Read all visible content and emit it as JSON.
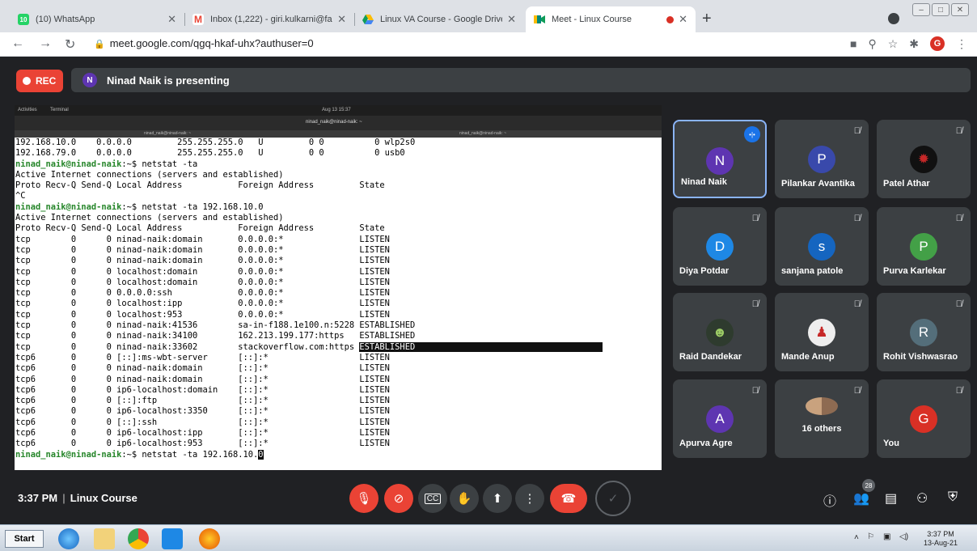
{
  "browser": {
    "tabs": [
      {
        "title": "(10) WhatsApp",
        "favicon": "whatsapp-icon",
        "color": "#25d366"
      },
      {
        "title": "Inbox (1,222) - giri.kulkarni@famt.a",
        "favicon": "gmail-icon",
        "color": "#ea4335"
      },
      {
        "title": "Linux VA Course - Google Drive",
        "favicon": "drive-icon",
        "color": "#fbbc04"
      },
      {
        "title": "Meet - Linux Course",
        "favicon": "meet-icon",
        "color": "#00897b"
      }
    ],
    "url": "meet.google.com/qgq-hkaf-uhx?authuser=0",
    "profile_initial": "G"
  },
  "meet": {
    "rec_label": "REC",
    "presenter_initial": "N",
    "presenting_text": "Ninad Naik is presenting",
    "time": "3:37 PM",
    "meeting_name": "Linux Course",
    "participant_count": "28"
  },
  "shared_screen": {
    "gnome_activities": "Activities",
    "gnome_app": "Terminal",
    "gnome_clock": "Aug 13 15:37",
    "window_title": "ninad_naik@ninad-naik: ~",
    "tab1": "ninad_naik@ninad-naik: ~",
    "tab2": "ninad_naik@ninad-naik: ~",
    "prompt": "ninad_naik@ninad-naik",
    "lines": [
      {
        "t": "192.168.10.0    0.0.0.0         255.255.255.0   U         0 0          0 wlp2s0"
      },
      {
        "t": "192.168.79.0    0.0.0.0         255.255.255.0   U         0 0          0 usb0"
      },
      {
        "prompt": true,
        "t": ":~$ netstat -ta"
      },
      {
        "t": "Active Internet connections (servers and established)"
      },
      {
        "t": "Proto Recv-Q Send-Q Local Address           Foreign Address         State"
      },
      {
        "t": "^C"
      },
      {
        "prompt": true,
        "t": ":~$ netstat -ta 192.168.10.0"
      },
      {
        "t": "Active Internet connections (servers and established)"
      },
      {
        "t": "Proto Recv-Q Send-Q Local Address           Foreign Address         State"
      },
      {
        "t": "tcp        0      0 ninad-naik:domain       0.0.0.0:*               LISTEN"
      },
      {
        "t": "tcp        0      0 ninad-naik:domain       0.0.0.0:*               LISTEN"
      },
      {
        "t": "tcp        0      0 ninad-naik:domain       0.0.0.0:*               LISTEN"
      },
      {
        "t": "tcp        0      0 localhost:domain        0.0.0.0:*               LISTEN"
      },
      {
        "t": "tcp        0      0 localhost:domain        0.0.0.0:*               LISTEN"
      },
      {
        "t": "tcp        0      0 0.0.0.0:ssh             0.0.0.0:*               LISTEN"
      },
      {
        "t": "tcp        0      0 localhost:ipp           0.0.0.0:*               LISTEN"
      },
      {
        "t": "tcp        0      0 localhost:953           0.0.0.0:*               LISTEN"
      },
      {
        "t": "tcp        0      0 ninad-naik:41536        sa-in-f188.1e100.n:5228 ESTABLISHED"
      },
      {
        "t": "tcp        0      0 ninad-naik:34100        162.213.199.177:https   ESTABLISHED"
      },
      {
        "t": "tcp        0      0 ninad-naik:33602        stackoverflow.com:https ",
        "hl": "ESTABLISHED                                     "
      },
      {
        "t": "tcp6       0      0 [::]:ms-wbt-server      [::]:*                  LISTEN"
      },
      {
        "t": "tcp6       0      0 ninad-naik:domain       [::]:*                  LISTEN"
      },
      {
        "t": "tcp6       0      0 ninad-naik:domain       [::]:*                  LISTEN"
      },
      {
        "t": "tcp6       0      0 ip6-localhost:domain    [::]:*                  LISTEN"
      },
      {
        "t": "tcp6       0      0 [::]:ftp                [::]:*                  LISTEN"
      },
      {
        "t": "tcp6       0      0 ip6-localhost:3350      [::]:*                  LISTEN"
      },
      {
        "t": "tcp6       0      0 [::]:ssh                [::]:*                  LISTEN"
      },
      {
        "t": "tcp6       0      0 ip6-localhost:ipp       [::]:*                  LISTEN"
      },
      {
        "t": "tcp6       0      0 ip6-localhost:953       [::]:*                  LISTEN"
      },
      {
        "prompt": true,
        "t": ":~$ netstat -ta 192.168.10.",
        "cursor": "0"
      }
    ]
  },
  "participants": [
    {
      "name": "Ninad Naik",
      "initial": "N",
      "color": "#5e35b1",
      "speaking": true
    },
    {
      "name": "Pilankar Avantika",
      "initial": "P",
      "color": "#3949ab"
    },
    {
      "name": "Patel Athar",
      "initial": "",
      "color": "#111111",
      "icon": "spider-icon"
    },
    {
      "name": "Diya Potdar",
      "initial": "D",
      "color": "#1e88e5"
    },
    {
      "name": "sanjana patole",
      "initial": "s",
      "color": "#1565c0"
    },
    {
      "name": "Purva Karlekar",
      "initial": "P",
      "color": "#43a047"
    },
    {
      "name": "Raid Dandekar",
      "initial": "",
      "color": "#2e3b2e",
      "icon": "joker-icon"
    },
    {
      "name": "Mande Anup",
      "initial": "",
      "color": "#eeeeee",
      "icon": "person-photo-icon"
    },
    {
      "name": "Rohit Vishwasrao",
      "initial": "R",
      "color": "#546e7a"
    },
    {
      "name": "Apurva Agre",
      "initial": "A",
      "color": "#5e35b1"
    },
    {
      "name": "16 others",
      "initial": "",
      "color": "#3c4043",
      "others": true
    },
    {
      "name": "You",
      "initial": "G",
      "color": "#d93025"
    }
  ],
  "taskbar": {
    "start_label": "Start",
    "clock_time": "3:37 PM",
    "clock_date": "13-Aug-21"
  }
}
